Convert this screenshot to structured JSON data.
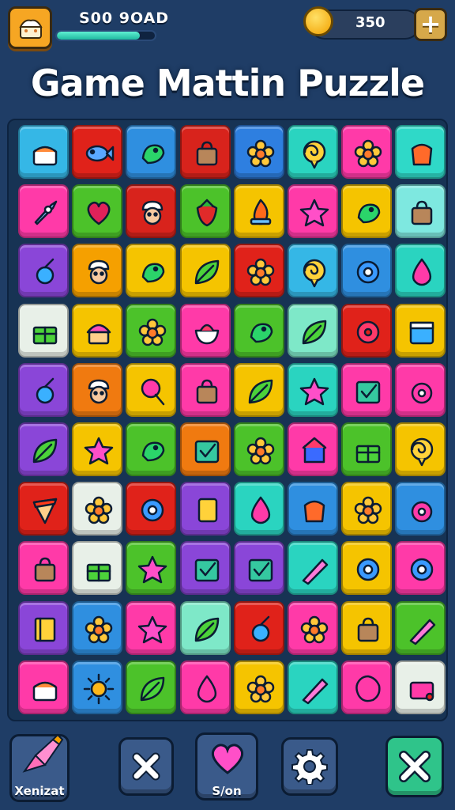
{
  "header": {
    "score_text": "S00 9OAD",
    "progress": 0.85,
    "coins": "350",
    "plus_label": "+"
  },
  "title": "Game Mattin Puzzle",
  "colors": {
    "background": "#1f3d66",
    "board": "#173354",
    "accent_teal": "#2fd3b5",
    "coin_gold": "#f2a100"
  },
  "board": {
    "rows": 10,
    "cols": 8,
    "tiles": [
      [
        "#35b7e6",
        "#e0221a",
        "#2f8fe0",
        "#d8231c",
        "#2e7fe0",
        "#2ad4c0",
        "#ff3aa8",
        "#2fd9c8"
      ],
      [
        "#ff3aa8",
        "#4cc22a",
        "#d8231c",
        "#4cc22a",
        "#f5c400",
        "#ff3aa8",
        "#f5c400",
        "#7ee8e0"
      ],
      [
        "#8a46d8",
        "#f5a000",
        "#f5c400",
        "#f5c400",
        "#e0221a",
        "#35b7e6",
        "#2f8fe0",
        "#2ad4c0"
      ],
      [
        "#e8f0e8",
        "#f5c400",
        "#4cc22a",
        "#ff3aa8",
        "#4cc22a",
        "#7ee8c8",
        "#e0221a",
        "#f5c400"
      ],
      [
        "#8a46d8",
        "#f07a10",
        "#f5c400",
        "#ff3aa8",
        "#f5c400",
        "#2ad4c0",
        "#ff3aa8",
        "#ff3aa8"
      ],
      [
        "#8a46d8",
        "#f5c400",
        "#4cc22a",
        "#f07a10",
        "#4cc22a",
        "#ff3aa8",
        "#4cc22a",
        "#f5c400"
      ],
      [
        "#e0221a",
        "#e8f0e8",
        "#e0221a",
        "#8a46d8",
        "#2ad4c0",
        "#2f8fe0",
        "#f5c400",
        "#2f8fe0"
      ],
      [
        "#ff3aa8",
        "#e8f0e8",
        "#4cc22a",
        "#8a46d8",
        "#8a46d8",
        "#2ad4c0",
        "#f5c400",
        "#ff3aa8"
      ],
      [
        "#8a46d8",
        "#2f8fe0",
        "#ff3aa8",
        "#7ee8c8",
        "#e0221a",
        "#ff3aa8",
        "#f5c400",
        "#4cc22a"
      ],
      [
        "#ff3aa8",
        "#2f8fe0",
        "#4cc22a",
        "#ff3aa8",
        "#f5c400",
        "#2ad4c0",
        "#ff3aa8",
        "#e8f0e8"
      ]
    ],
    "icons": [
      [
        "cake",
        "fish",
        "bird",
        "bag",
        "flower",
        "spiral",
        "flower",
        "pot"
      ],
      [
        "rocket",
        "heart",
        "chef",
        "strawberry",
        "fire",
        "star",
        "bird",
        "bag"
      ],
      [
        "candy",
        "chef",
        "bird",
        "leaf",
        "flower",
        "spiral",
        "gear",
        "drop"
      ],
      [
        "gift",
        "muffin",
        "flower",
        "bowl",
        "bird",
        "leaf",
        "donut",
        "box"
      ],
      [
        "candy",
        "chef",
        "lollipop",
        "bag",
        "leaf",
        "star",
        "check",
        "onion"
      ],
      [
        "leaf",
        "star",
        "bird",
        "check",
        "flower",
        "house",
        "gift",
        "spiral"
      ],
      [
        "pizza",
        "flower",
        "gear",
        "card",
        "drop",
        "pot",
        "flower",
        "onion"
      ],
      [
        "bag",
        "gift",
        "star",
        "check",
        "check",
        "pen",
        "gear",
        "gear"
      ],
      [
        "book",
        "flower",
        "star",
        "leaf",
        "candy",
        "flower",
        "bag",
        "pen"
      ],
      [
        "cake",
        "sun",
        "leaf",
        "drop",
        "flower",
        "pen",
        "blob",
        "camera"
      ]
    ]
  },
  "bottom": {
    "left_label": "Xenizat",
    "heart_label": "S/on"
  }
}
